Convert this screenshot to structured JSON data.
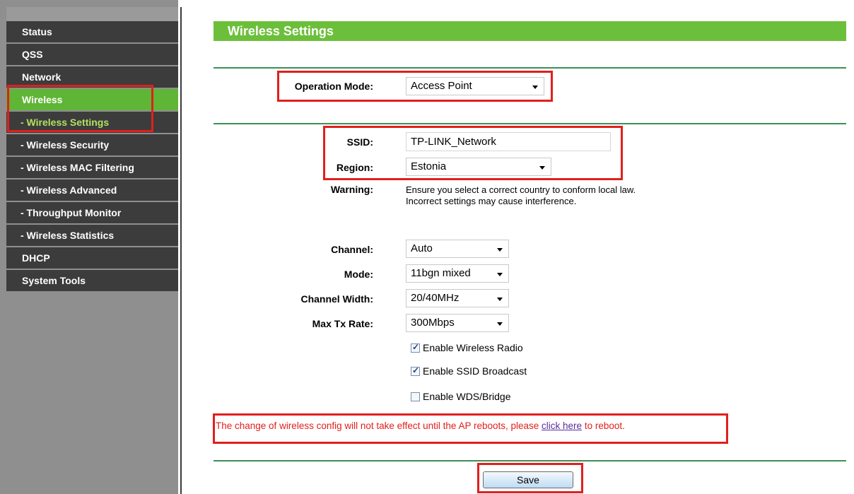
{
  "sidebar": {
    "items": [
      {
        "label": "Status"
      },
      {
        "label": "QSS"
      },
      {
        "label": "Network"
      },
      {
        "label": "Wireless"
      },
      {
        "label": "- Wireless Settings"
      },
      {
        "label": "- Wireless Security"
      },
      {
        "label": "- Wireless MAC Filtering"
      },
      {
        "label": "- Wireless Advanced"
      },
      {
        "label": "- Throughput Monitor"
      },
      {
        "label": "- Wireless Statistics"
      },
      {
        "label": "DHCP"
      },
      {
        "label": "System Tools"
      }
    ]
  },
  "page": {
    "title": "Wireless Settings"
  },
  "form": {
    "operation_mode": {
      "label": "Operation Mode:",
      "value": "Access Point"
    },
    "ssid": {
      "label": "SSID:",
      "value": "TP-LINK_Network"
    },
    "region": {
      "label": "Region:",
      "value": "Estonia"
    },
    "warning": {
      "label": "Warning:",
      "line1": "Ensure you select a correct country to conform local law.",
      "line2": "Incorrect settings may cause interference."
    },
    "channel": {
      "label": "Channel:",
      "value": "Auto"
    },
    "mode": {
      "label": "Mode:",
      "value": "11bgn mixed"
    },
    "channel_width": {
      "label": "Channel Width:",
      "value": "20/40MHz"
    },
    "max_tx_rate": {
      "label": "Max Tx Rate:",
      "value": "300Mbps"
    },
    "checkboxes": [
      {
        "label": "Enable Wireless Radio",
        "checked": true
      },
      {
        "label": "Enable SSID Broadcast",
        "checked": true
      },
      {
        "label": "Enable WDS/Bridge",
        "checked": false
      }
    ]
  },
  "notice": {
    "before": "The change of wireless config will not take effect until the AP reboots, please ",
    "link": "click here",
    "after": " to reboot."
  },
  "save_label": "Save",
  "colors": {
    "accent_green": "#6cbf3a",
    "highlight_red": "#e0201c",
    "menu_dark": "#3c3c3c"
  }
}
